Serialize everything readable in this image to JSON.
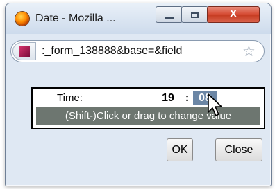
{
  "window": {
    "title": "Date - Mozilla ...",
    "close_glyph": "X"
  },
  "urlbar": {
    "url": ":_form_138888&base=&field",
    "bookmark_icon": "star-icon"
  },
  "picker": {
    "time_label": "Time:",
    "hour": "19",
    "separator": ":",
    "minute": "08",
    "hint": "(Shift-)Click or drag to change value"
  },
  "buttons": {
    "ok": "OK",
    "close": "Close"
  },
  "colors": {
    "minute_highlight": "#6b86a5",
    "hint_bar": "#6d7670",
    "close_button": "#d64c34"
  }
}
